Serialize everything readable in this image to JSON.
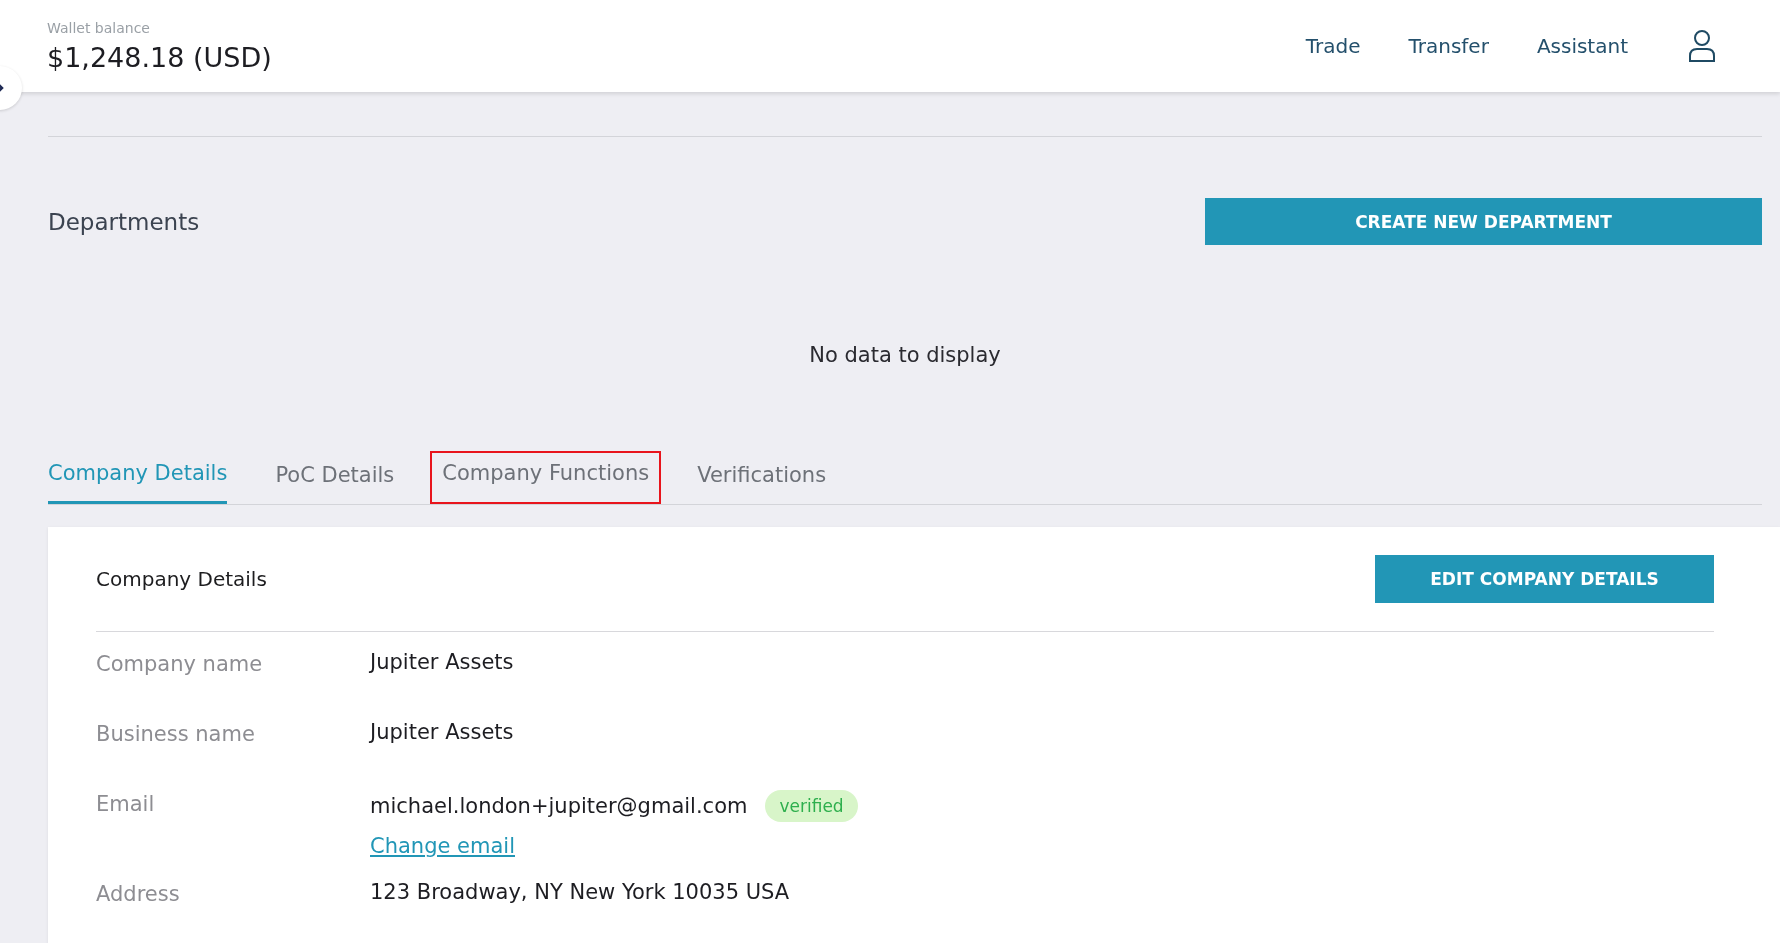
{
  "header": {
    "wallet_label": "Wallet balance",
    "wallet_balance": "$1,248.18 (USD)",
    "nav": [
      "Trade",
      "Transfer",
      "Assistant"
    ]
  },
  "departments": {
    "title": "Departments",
    "button": "CREATE NEW DEPARTMENT",
    "empty": "No data to display"
  },
  "tabs": [
    {
      "label": "Company Details",
      "selected": true,
      "highlighted": false
    },
    {
      "label": "PoC Details",
      "selected": false,
      "highlighted": false
    },
    {
      "label": "Company Functions",
      "selected": false,
      "highlighted": true
    },
    {
      "label": "Verifications",
      "selected": false,
      "highlighted": false
    }
  ],
  "card": {
    "title": "Company Details",
    "button": "EDIT COMPANY DETAILS",
    "rows": [
      {
        "label": "Company name",
        "value": "Jupiter Assets"
      },
      {
        "label": "Business name",
        "value": "Jupiter Assets"
      },
      {
        "label": "Email",
        "value": "michael.london+jupiter@gmail.com",
        "badge": "verified",
        "link": "Change email"
      },
      {
        "label": "Address",
        "value": "123 Broadway, NY New York 10035 USA"
      }
    ]
  }
}
